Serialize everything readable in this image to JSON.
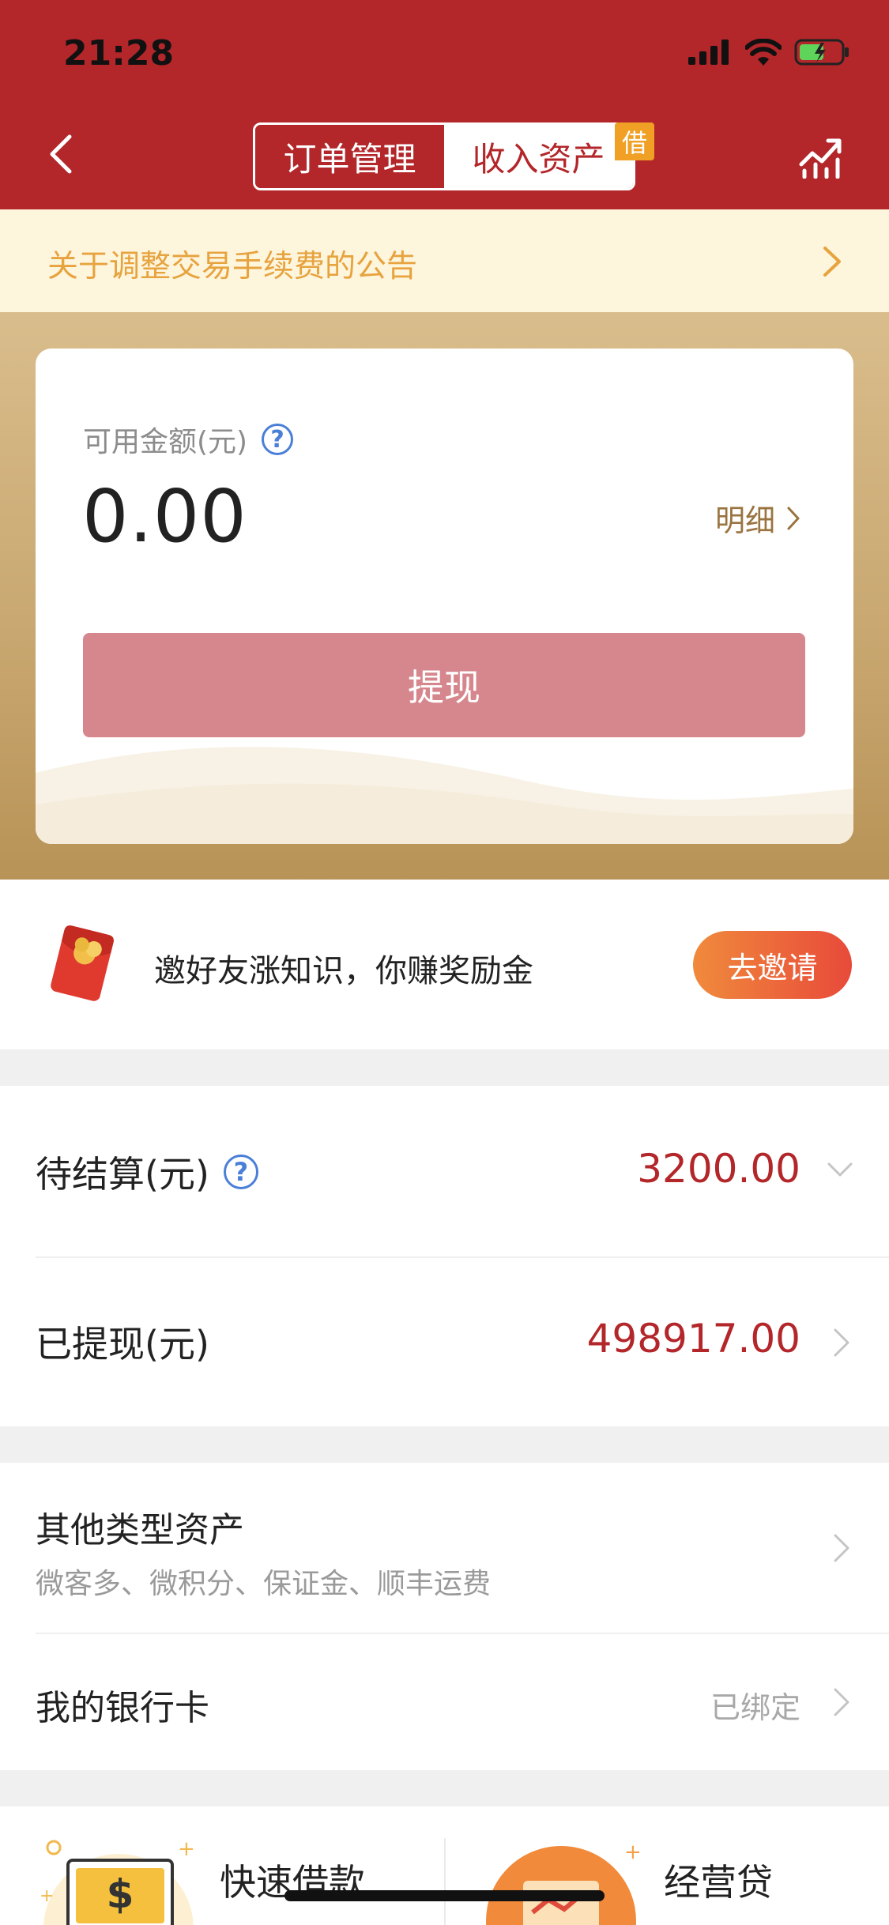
{
  "status_bar": {
    "time": "21:28"
  },
  "header": {
    "tabs": [
      "订单管理",
      "收入资产"
    ],
    "badge": "借"
  },
  "notice": {
    "text": "关于调整交易手续费的公告"
  },
  "balance_card": {
    "label": "可用金额(元)",
    "help": "?",
    "amount": "0.00",
    "detail_label": "明细",
    "withdraw_label": "提现"
  },
  "invite": {
    "text": "邀好友涨知识，你赚奖励金",
    "button": "去邀请"
  },
  "pending": {
    "label": "待结算(元)",
    "help": "?",
    "amount": "3200.00"
  },
  "withdrawn": {
    "label": "已提现(元)",
    "amount": "498917.00"
  },
  "other_assets": {
    "label": "其他类型资产",
    "sub": "微客多、微积分、保证金、顺丰运费"
  },
  "bank_card": {
    "label": "我的银行卡",
    "status": "已绑定"
  },
  "services": [
    {
      "label": "快速借款",
      "icon": "dollar-bill-icon"
    },
    {
      "label": "经营贷",
      "icon": "business-loan-icon"
    }
  ],
  "colors": {
    "header": "#b3262a",
    "notice_bg": "#fef5dd",
    "notice_text": "#e7a33e",
    "amount": "#b3262a",
    "withdraw_button": "#d6878e"
  }
}
